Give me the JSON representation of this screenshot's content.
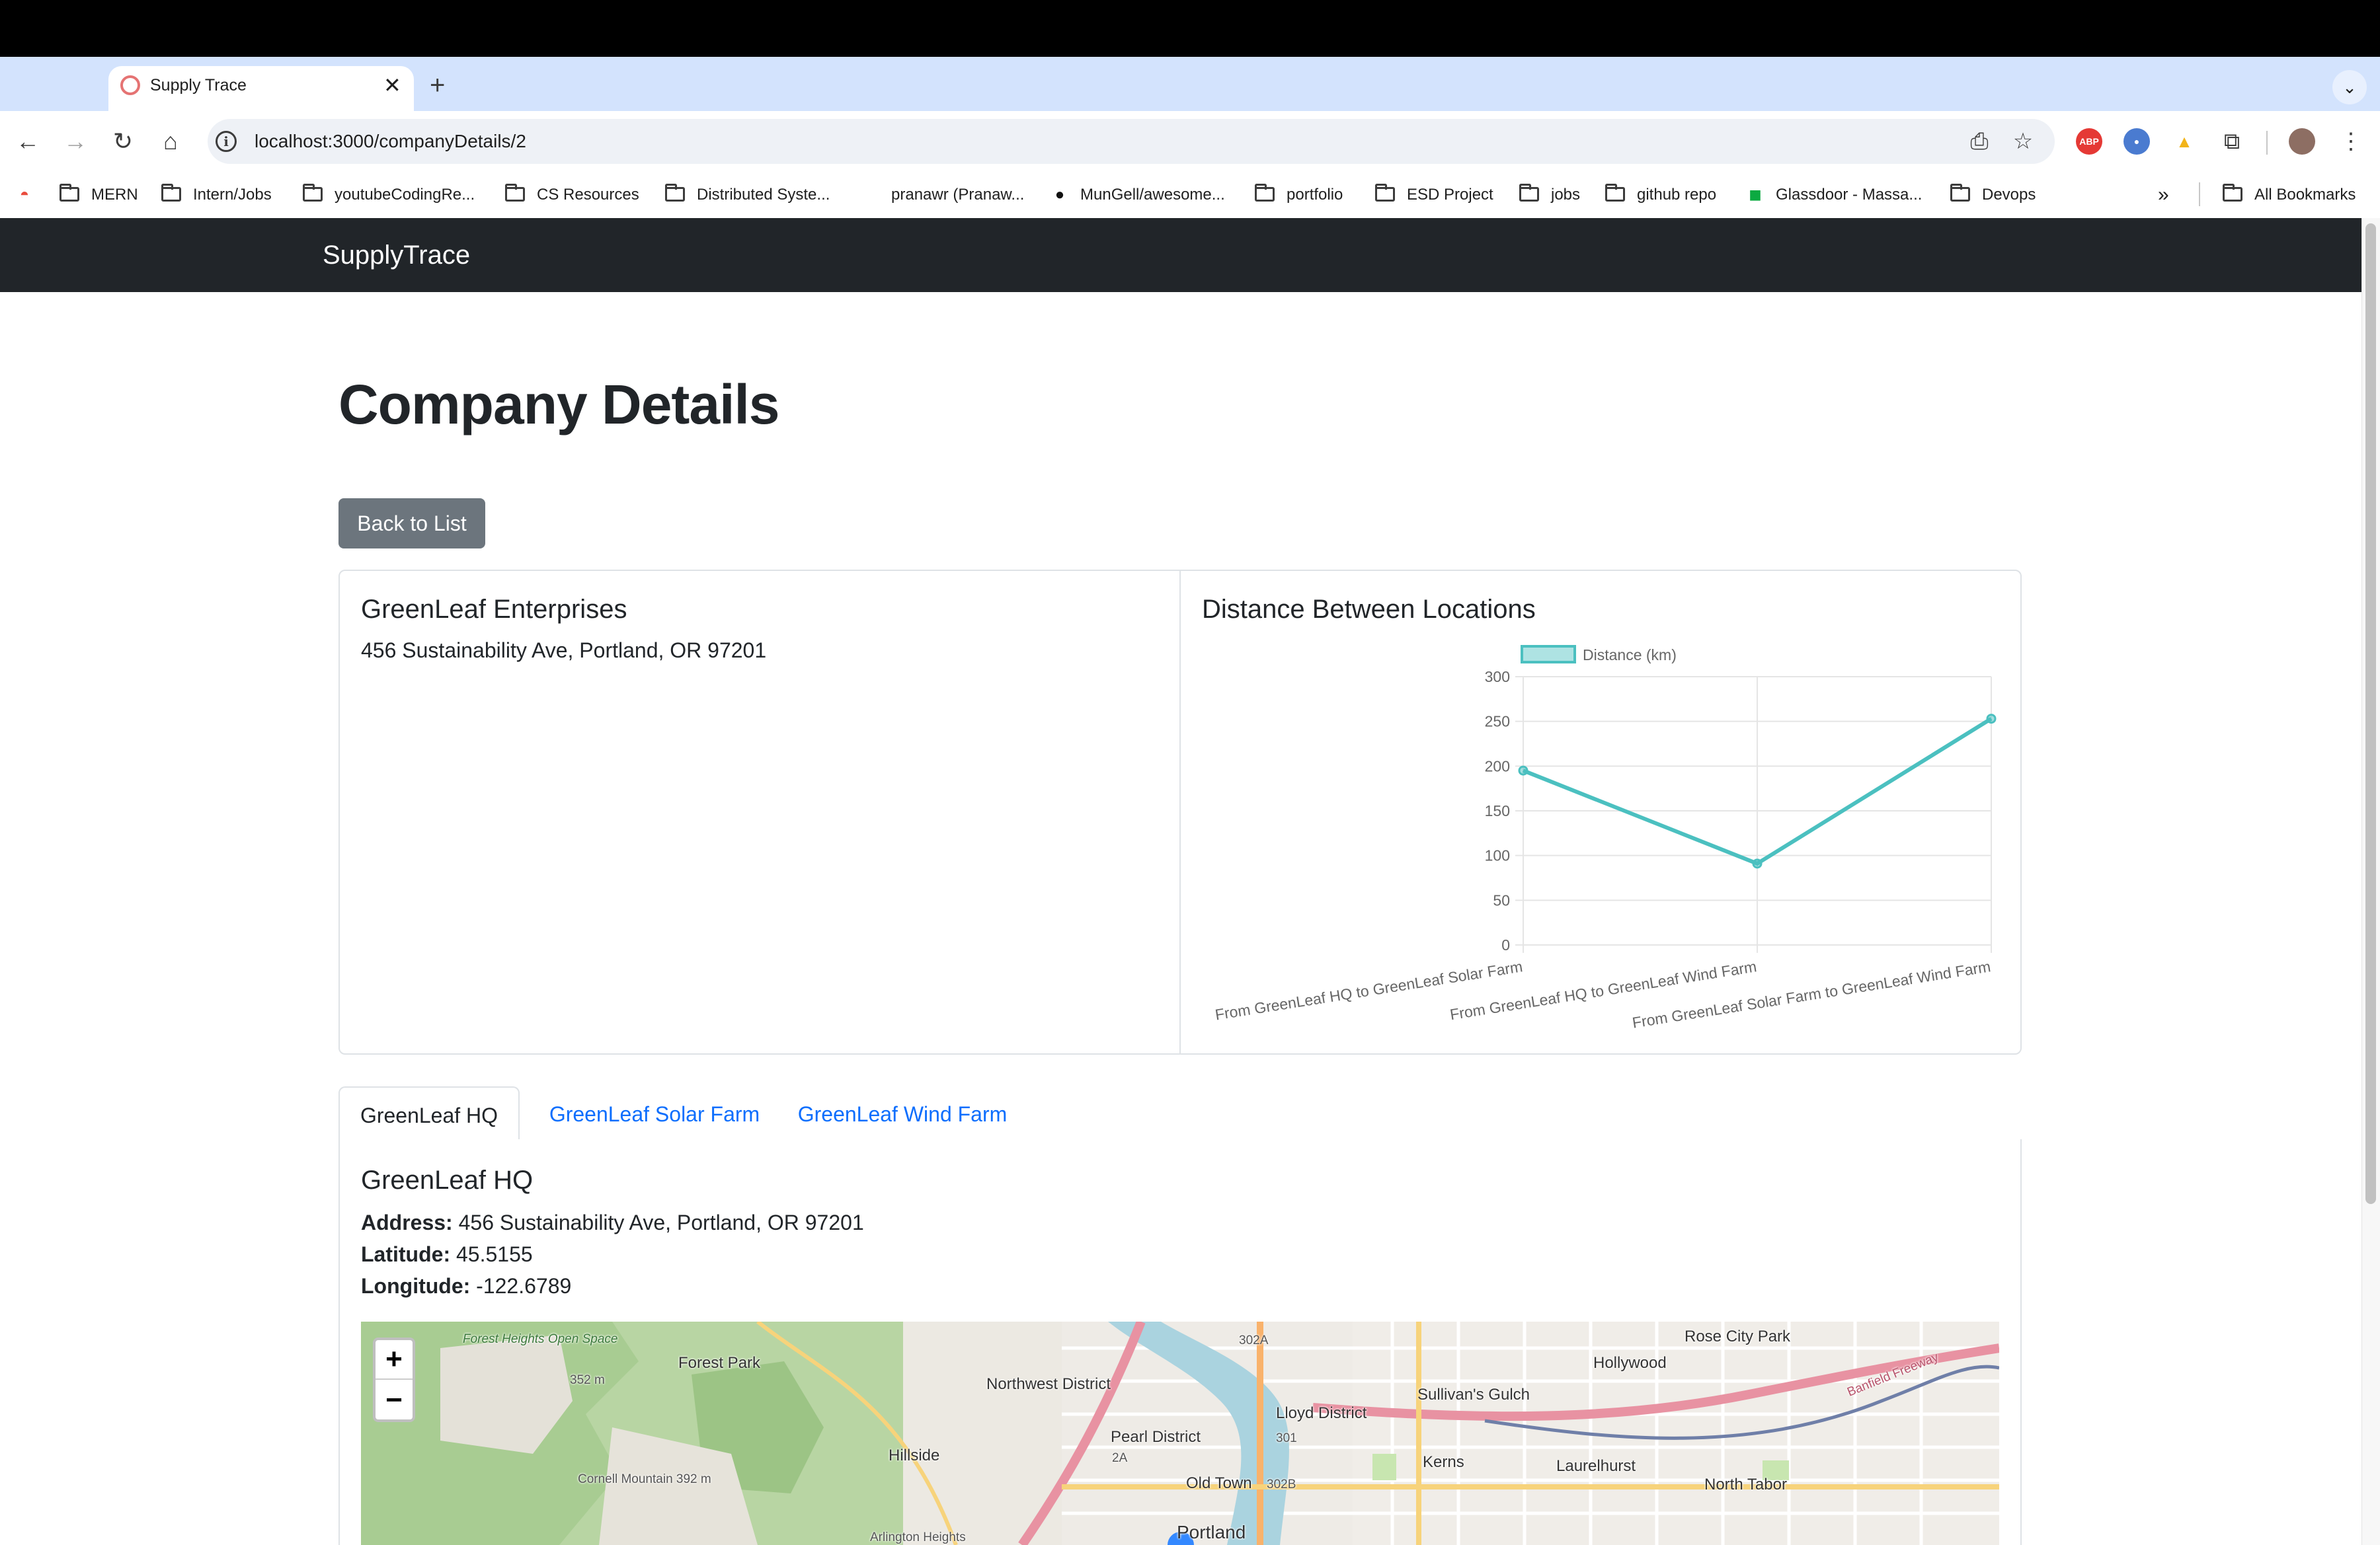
{
  "browser": {
    "tab_title": "Supply Trace",
    "url": "localhost:3000/companyDetails/2",
    "bookmarks": [
      {
        "label": "MERN",
        "icon": "folder-icon"
      },
      {
        "label": "Intern/Jobs",
        "icon": "folder-icon"
      },
      {
        "label": "youtubeCodingRe...",
        "icon": "folder-icon"
      },
      {
        "label": "CS Resources",
        "icon": "folder-icon"
      },
      {
        "label": "Distributed Syste...",
        "icon": "folder-icon"
      },
      {
        "label": "pranawr (Pranaw...",
        "icon": "page-icon"
      },
      {
        "label": "MunGell/awesome...",
        "icon": "github-icon"
      },
      {
        "label": "portfolio",
        "icon": "folder-icon"
      },
      {
        "label": "ESD Project",
        "icon": "folder-icon"
      },
      {
        "label": "jobs",
        "icon": "folder-icon"
      },
      {
        "label": "github repo",
        "icon": "folder-icon"
      },
      {
        "label": "Glassdoor - Massa...",
        "icon": "glassdoor-icon"
      },
      {
        "label": "Devops",
        "icon": "folder-icon"
      }
    ],
    "all_bookmarks": "All Bookmarks",
    "extensions": [
      {
        "name": "adblock-plus-icon",
        "text": "ABP",
        "color": "#e53935"
      },
      {
        "name": "extension-globe-icon",
        "text": "",
        "color": "#4a7bd0"
      },
      {
        "name": "extension-bee-icon",
        "text": "",
        "color": "#f2b41a"
      }
    ]
  },
  "app": {
    "brand": "SupplyTrace",
    "page_title": "Company Details",
    "back_button": "Back to List",
    "company": {
      "name": "GreenLeaf Enterprises",
      "address": "456 Sustainability Ave, Portland, OR 97201"
    },
    "chart_title": "Distance Between Locations",
    "tabs": [
      {
        "label": "GreenLeaf HQ",
        "active": true
      },
      {
        "label": "GreenLeaf Solar Farm",
        "active": false
      },
      {
        "label": "GreenLeaf Wind Farm",
        "active": false
      }
    ],
    "location": {
      "name": "GreenLeaf HQ",
      "address_label": "Address:",
      "address": "456 Sustainability Ave, Portland, OR 97201",
      "latitude_label": "Latitude:",
      "latitude": "45.5155",
      "longitude_label": "Longitude:",
      "longitude": "-122.6789"
    },
    "map": {
      "zoom_in": "+",
      "zoom_out": "−",
      "labels": [
        "Forest Heights Open Space",
        "Forest Park",
        "352 m",
        "Cornell Mountain 392 m",
        "Hillside",
        "Northwest District",
        "Pearl District",
        "Old Town",
        "Portland",
        "Arlington Heights",
        "Lloyd District",
        "Sullivan's Gulch",
        "Kerns",
        "Laurelhurst",
        "Hollywood",
        "Rose City Park",
        "North Tabor",
        "Banfield Freeway",
        "302A",
        "302B",
        "301",
        "2A"
      ]
    }
  },
  "colors": {
    "navbar": "#212529",
    "line": "#4bc0c0",
    "link": "#0d6efd",
    "secondary_button": "#6c757d"
  },
  "chart_data": {
    "type": "line",
    "categories": [
      "From GreenLeaf HQ to GreenLeaf Solar Farm",
      "From GreenLeaf HQ to GreenLeaf Wind Farm",
      "From GreenLeaf Solar Farm to GreenLeaf Wind Farm"
    ],
    "series": [
      {
        "name": "Distance (km)",
        "values": [
          195,
          91,
          253
        ]
      }
    ],
    "ylim": [
      0,
      300
    ],
    "yticks": [
      0,
      50,
      100,
      150,
      200,
      250,
      300
    ],
    "grid": true,
    "legend": "top"
  }
}
